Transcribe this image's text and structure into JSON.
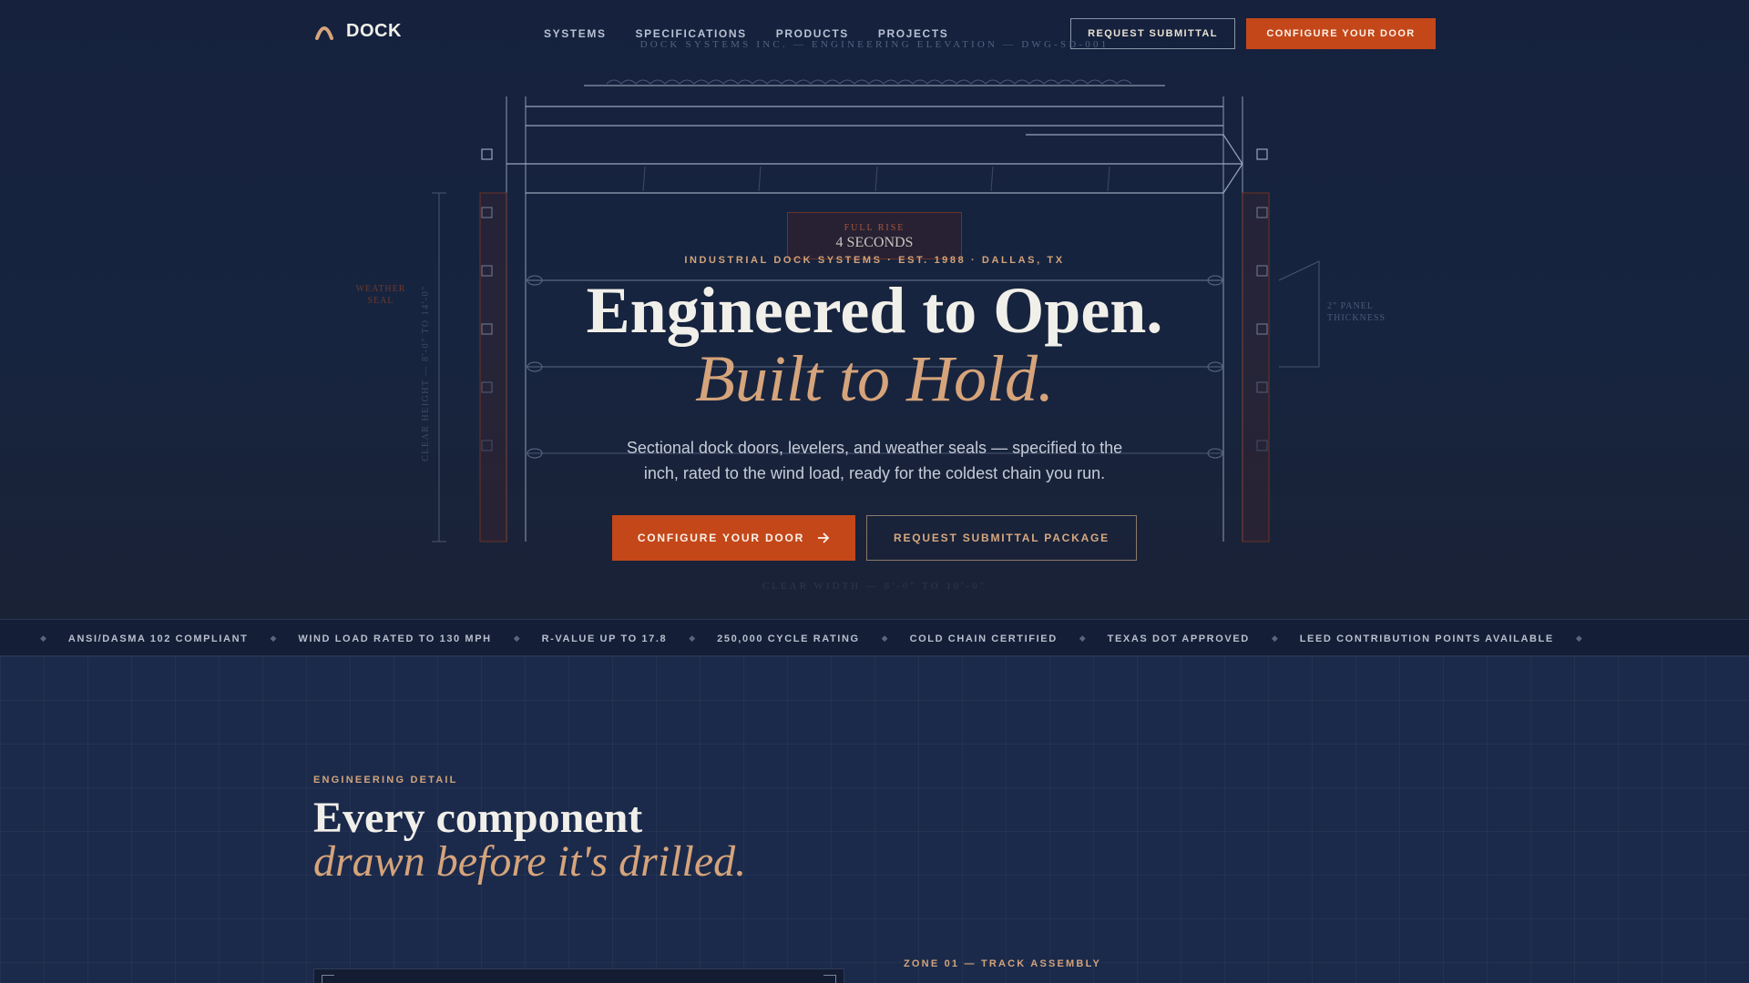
{
  "brand": {
    "name": "DOCK",
    "logo_icon": "arch-mark-icon",
    "accent": "#c4471a",
    "gold": "#d6a47b"
  },
  "nav": {
    "links": [
      "SYSTEMS",
      "SPECIFICATIONS",
      "PRODUCTS",
      "PROJECTS"
    ],
    "request_label": "REQUEST SUBMITTAL",
    "configure_label": "CONFIGURE YOUR DOOR"
  },
  "blueprint": {
    "drawing_title": "DOCK SYSTEMS INC. — ENGINEERING ELEVATION — DWG-SD-001",
    "weather_seal_line1": "WEATHER",
    "weather_seal_line2": "SEAL",
    "clear_height": "CLEAR HEIGHT — 8'-0\" TO 14'-0\"",
    "panel_line1": "2\" PANEL",
    "panel_line2": "THICKNESS",
    "badge_label": "FULL RISE",
    "badge_value": "4 SECONDS",
    "clear_width": "CLEAR WIDTH — 8'-0\" TO 10'-0\""
  },
  "hero": {
    "eyebrow": "INDUSTRIAL DOCK SYSTEMS · EST. 1988 · DALLAS, TX",
    "title": "Engineered to Open.",
    "title_em": "Built to Hold.",
    "lede": "Sectional dock doors, levelers, and weather seals — specified to the inch, rated to the wind load, ready for the coldest chain you run.",
    "primary_cta": "CONFIGURE YOUR DOOR",
    "secondary_cta": "REQUEST SUBMITTAL PACKAGE"
  },
  "ticker": {
    "items": [
      "ANSI/DASMA 102 COMPLIANT",
      "WIND LOAD RATED TO 130 MPH",
      "R-VALUE UP TO 17.8",
      "250,000 CYCLE RATING",
      "COLD CHAIN CERTIFIED",
      "TEXAS DOT APPROVED",
      "LEED CONTRIBUTION POINTS AVAILABLE"
    ]
  },
  "engineering": {
    "eyebrow": "ENGINEERING DETAIL",
    "title": "Every component",
    "title_em": "drawn before it's drilled.",
    "zone_label": "ZONE 01 — TRACK ASSEMBLY"
  }
}
